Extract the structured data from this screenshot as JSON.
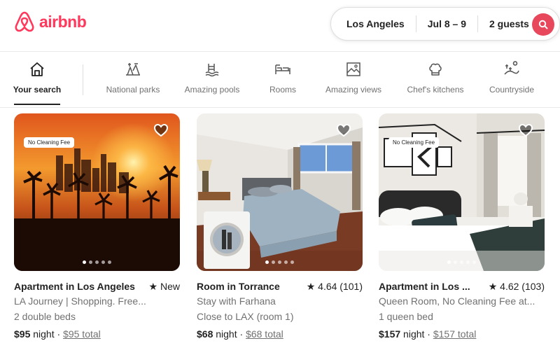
{
  "brand": {
    "name": "airbnb",
    "color": "#ff385c"
  },
  "search": {
    "location": "Los Angeles",
    "dates": "Jul 8 – 9",
    "guests": "2 guests",
    "button_icon": "search-icon"
  },
  "categories": [
    {
      "label": "Your search",
      "icon": "house-icon",
      "active": true
    },
    {
      "label": "National parks",
      "icon": "national-parks-icon"
    },
    {
      "label": "Amazing pools",
      "icon": "pool-icon"
    },
    {
      "label": "Rooms",
      "icon": "bed-icon"
    },
    {
      "label": "Amazing views",
      "icon": "views-icon"
    },
    {
      "label": "Chef's kitchens",
      "icon": "chef-hat-icon"
    },
    {
      "label": "Countryside",
      "icon": "countryside-icon"
    }
  ],
  "listings": [
    {
      "title": "Apartment in Los Angeles",
      "rating_star": "★",
      "rating": "New",
      "line1": "LA Journey | Shopping. Free...",
      "line2": "2 double beds",
      "price": "$95",
      "price_unit": " night · ",
      "total": "$95 total",
      "badge": "No Cleaning Fee",
      "photo_dots": 5,
      "active_dot": 1
    },
    {
      "title": "Room in Torrance",
      "rating_star": "★",
      "rating": "4.64 (101)",
      "line1": "Stay with Farhana",
      "line2": "Close to LAX (room 1)",
      "price": "$68",
      "price_unit": " night · ",
      "total": "$68 total",
      "badge": "",
      "photo_dots": 5,
      "active_dot": 1
    },
    {
      "title": "Apartment in Los ...",
      "rating_star": "★",
      "rating": "4.62 (103)",
      "line1": "Queen Room, No Cleaning Fee at...",
      "line2": "1 queen bed",
      "price": "$157",
      "price_unit": " night · ",
      "total": "$157 total",
      "badge": "No Cleaning Fee",
      "photo_dots": 5,
      "active_dot": 1
    }
  ]
}
